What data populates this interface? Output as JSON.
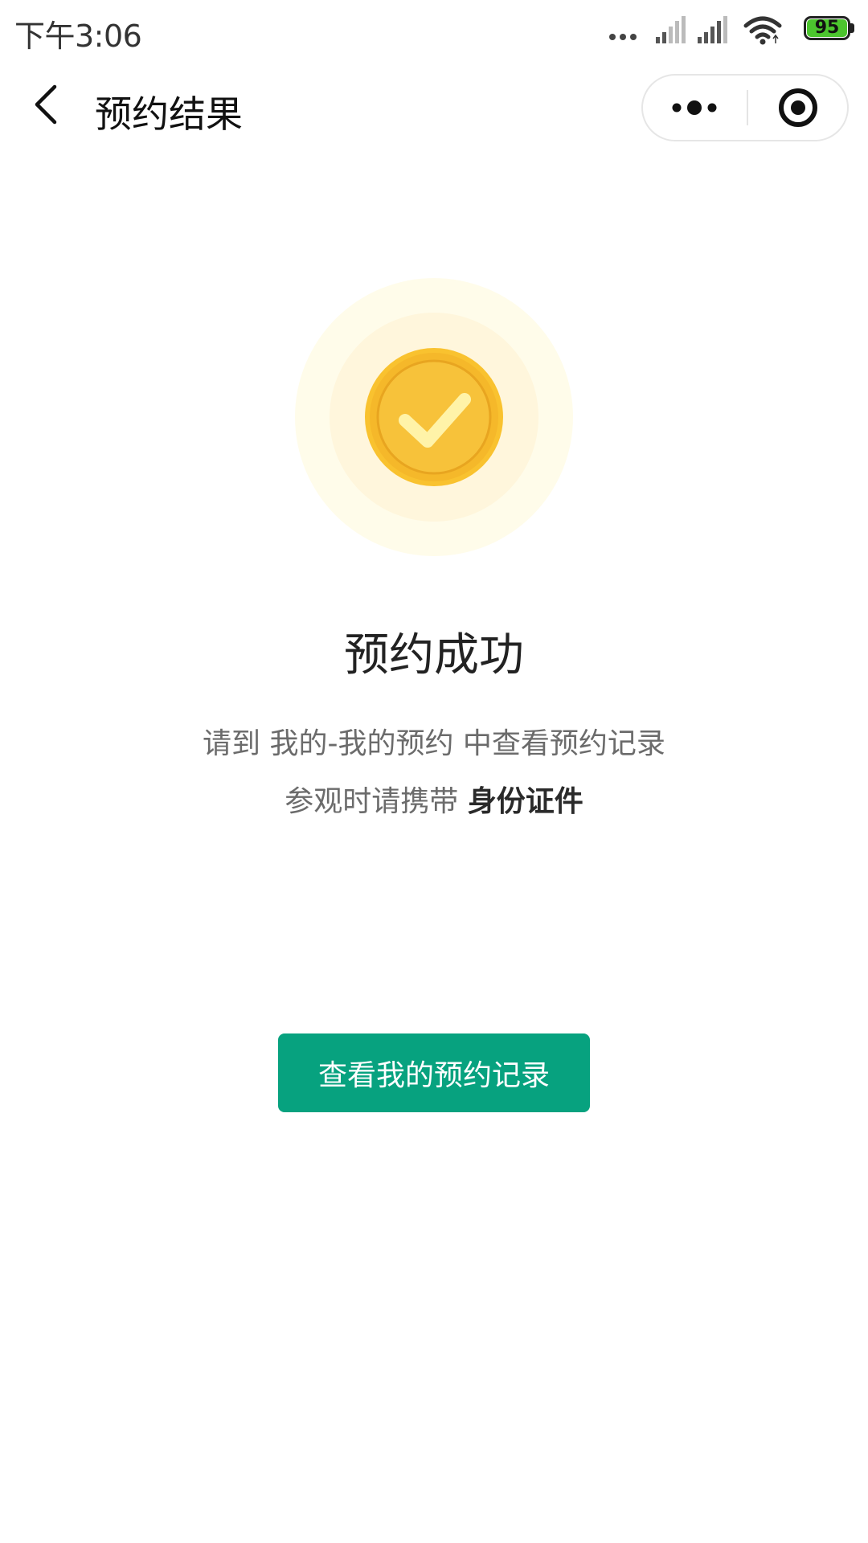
{
  "status_bar": {
    "time": "下午3:06",
    "battery_level": "95",
    "icons": [
      "dots-icon",
      "signal-icon",
      "signal-icon",
      "wifi-icon",
      "battery-icon"
    ]
  },
  "nav": {
    "title": "预约结果",
    "back_icon": "chevron-left-icon",
    "more_icon": "more-dots-icon",
    "close_icon": "target-circle-icon"
  },
  "result": {
    "icon": "success-check-icon",
    "title": "预约成功",
    "line1": "请到 我的-我的预约 中查看预约记录",
    "line2_prefix": "参观时请携带 ",
    "line2_strong": "身份证件"
  },
  "button": {
    "label": "查看我的预约记录",
    "color": "#07a27f"
  },
  "colors": {
    "accent": "#07a27f",
    "coin_gold": "#f9be2b",
    "halo": "#fffbe6"
  }
}
